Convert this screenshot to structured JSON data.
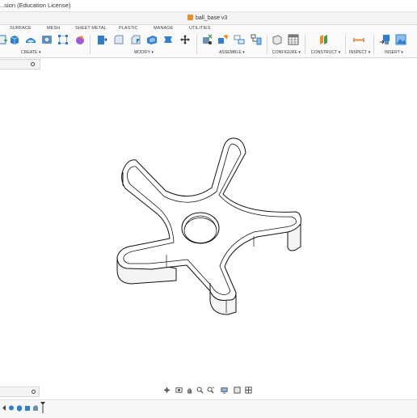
{
  "window": {
    "title": "...sion (Education License)"
  },
  "document_tab": {
    "title": "ball_base v3",
    "icon": "document-icon"
  },
  "workspace_tabs": [
    {
      "label": "SURFACE"
    },
    {
      "label": "MESH"
    },
    {
      "label": "SHEET METAL"
    },
    {
      "label": "PLASTIC"
    },
    {
      "label": "MANAGE"
    },
    {
      "label": "UTILITIES"
    }
  ],
  "toolbar_groups": [
    {
      "label": "CREATE ▾"
    },
    {
      "label": "MODIFY ▾"
    },
    {
      "label": "ASSEMBLE ▾"
    },
    {
      "label": "CONFIGURE ▾"
    },
    {
      "label": "CONSTRUCT ▾"
    },
    {
      "label": "INSPECT ▾"
    },
    {
      "label": "INSERT ▾"
    }
  ],
  "colors": {
    "blue_tool": "#2e7fd1",
    "orange_doc": "#f08b2a",
    "green_construct": "#3fa345",
    "purple_create": "#a05ad6",
    "model_stroke": "#111111"
  },
  "viewport": {
    "model_name": "ball_base",
    "model_type": "five-lobed star plate with central hole"
  }
}
